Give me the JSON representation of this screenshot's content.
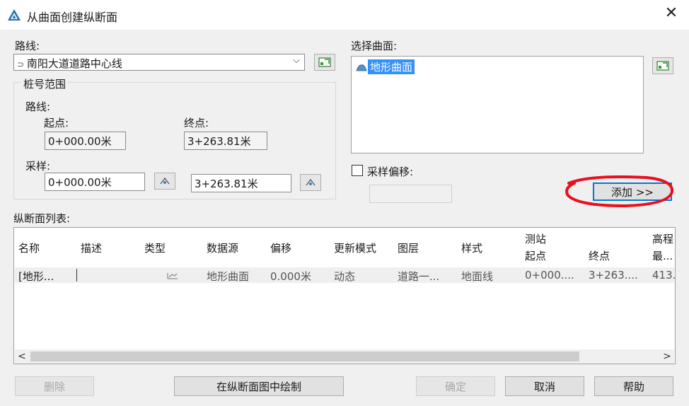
{
  "window": {
    "title": "从曲面创建纵断面",
    "close_glyph": "✕"
  },
  "alignment": {
    "label": "路线:",
    "value": "南阳大道道路中心线",
    "chevron": "⌵"
  },
  "station_range": {
    "group_label": "桩号范围",
    "alignment_label": "路线:",
    "start_label": "起点:",
    "end_label": "终点:",
    "start_value": "0+000.00米",
    "end_value": "3+263.81米",
    "sample_label": "采样:",
    "sample_start_value": "0+000.00米",
    "sample_end_value": "3+263.81米"
  },
  "surfaces": {
    "label": "选择曲面:",
    "items": [
      "地形曲面"
    ]
  },
  "sample_offset": {
    "label": "采样偏移:",
    "checked": false
  },
  "add_button": {
    "label": "添加 >>"
  },
  "profile_list": {
    "label": "纵断面列表:",
    "columns": [
      "名称",
      "描述",
      "类型",
      "数据源",
      "偏移",
      "更新模式",
      "图层",
      "样式",
      "测站",
      "起点",
      "终点",
      "高程",
      "最..."
    ],
    "rows": [
      {
        "name": "[地形...",
        "description": "",
        "data_source": "地形曲面",
        "offset": "0.000米",
        "update_mode": "动态",
        "layer": "道路一...",
        "style": "地面线",
        "start": "0+000....",
        "end": "3+263....",
        "elev_min": "413."
      }
    ],
    "scroll_left": "<",
    "scroll_right": ">"
  },
  "buttons": {
    "delete": "删除",
    "draw_in_profile_view": "在纵断面图中绘制",
    "ok": "确定",
    "cancel": "取消",
    "help": "帮助"
  },
  "colors": {
    "accent": "#0078d7",
    "selection": "#3390ff",
    "annotation_red": "#e8101e"
  }
}
